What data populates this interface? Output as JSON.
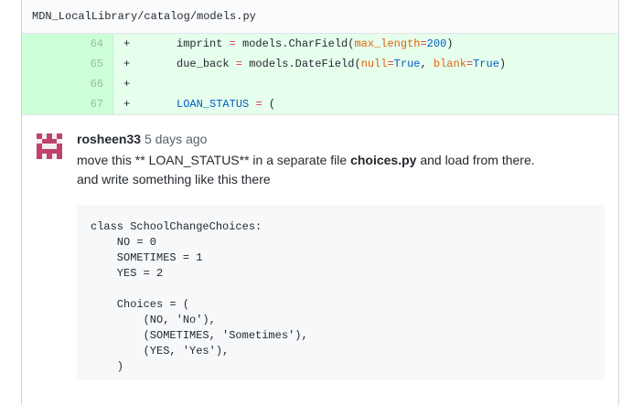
{
  "file": {
    "path": "MDN_LocalLibrary/catalog/models.py"
  },
  "diff": {
    "lines": [
      {
        "num": "64",
        "marker": "+",
        "indent": "    ",
        "tokens": [
          {
            "t": "imprint ",
            "c": ""
          },
          {
            "t": "=",
            "c": "tk-op"
          },
          {
            "t": " models.CharField(",
            "c": ""
          },
          {
            "t": "max_length",
            "c": "tk-param"
          },
          {
            "t": "=",
            "c": "tk-op"
          },
          {
            "t": "200",
            "c": "tk-num"
          },
          {
            "t": ")",
            "c": ""
          }
        ]
      },
      {
        "num": "65",
        "marker": "+",
        "indent": "    ",
        "tokens": [
          {
            "t": "due_back ",
            "c": ""
          },
          {
            "t": "=",
            "c": "tk-op"
          },
          {
            "t": " models.DateField(",
            "c": ""
          },
          {
            "t": "null",
            "c": "tk-param"
          },
          {
            "t": "=",
            "c": "tk-op"
          },
          {
            "t": "True",
            "c": "tk-bool"
          },
          {
            "t": ", ",
            "c": ""
          },
          {
            "t": "blank",
            "c": "tk-param"
          },
          {
            "t": "=",
            "c": "tk-op"
          },
          {
            "t": "True",
            "c": "tk-bool"
          },
          {
            "t": ")",
            "c": ""
          }
        ]
      },
      {
        "num": "66",
        "marker": "+",
        "indent": "",
        "tokens": []
      },
      {
        "num": "67",
        "marker": "+",
        "indent": "    ",
        "tokens": [
          {
            "t": "LOAN_STATUS",
            "c": "tk-name"
          },
          {
            "t": " ",
            "c": ""
          },
          {
            "t": "=",
            "c": "tk-op"
          },
          {
            "t": " (",
            "c": ""
          }
        ]
      }
    ]
  },
  "comment": {
    "author": "rosheen33",
    "time": "5 days ago",
    "line1_pre": "move this ** LOAN_STATUS** in a separate file ",
    "line1_bold": "choices.py",
    "line1_post": " and load from there.",
    "line2": "and write something like this there",
    "code": "class SchoolChangeChoices:\n    NO = 0\n    SOMETIMES = 1\n    YES = 2\n\n    Choices = (\n        (NO, 'No'),\n        (SOMETIMES, 'Sometimes'),\n        (YES, 'Yes'),\n    )"
  },
  "colors": {
    "avatar": "#c1426e",
    "added_line_bg": "#e6ffed",
    "added_num_bg": "#cdffd8"
  }
}
